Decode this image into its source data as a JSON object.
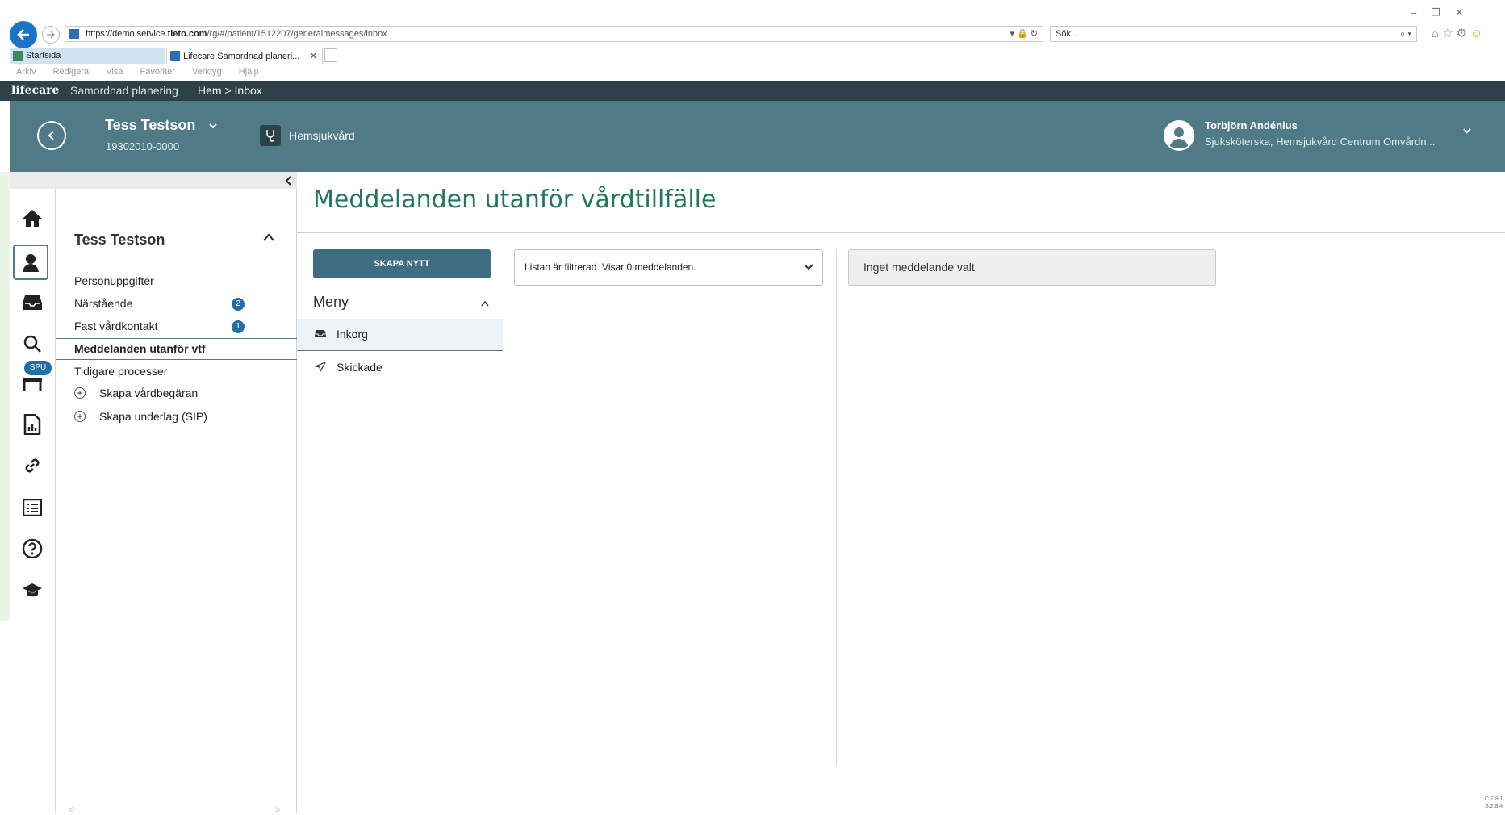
{
  "browser": {
    "url_prefix": "https://demo.service.",
    "url_domain": "tieto.com",
    "url_path": "/rg/#/patient/1512207/generalmessages/inbox",
    "search_placeholder": "Sök...",
    "tabs": [
      {
        "label": "Startsida"
      },
      {
        "label": "Lifecare Samordnad planeri..."
      }
    ],
    "menu": [
      "Arkiv",
      "Redigera",
      "Visa",
      "Favoriter",
      "Verktyg",
      "Hjälp"
    ]
  },
  "app": {
    "brand": "lifecare",
    "module": "Samordnad planering",
    "breadcrumb": "Hem > Inbox"
  },
  "patient": {
    "name": "Tess Testson",
    "id": "19302010-0000",
    "unit": "Hemsjukvård"
  },
  "user": {
    "name": "Torbjörn Andénius",
    "role": "Sjuksköterska, Hemsjukvård Centrum Omvårdn..."
  },
  "rail": {
    "spu_badge": "SPU"
  },
  "nav": {
    "title": "Tess Testson",
    "items": [
      {
        "label": "Personuppgifter"
      },
      {
        "label": "Närstående",
        "badge": "2"
      },
      {
        "label": "Fast vårdkontakt",
        "badge": "1"
      },
      {
        "label": "Meddelanden utanför vtf"
      },
      {
        "label": "Tidigare processer"
      },
      {
        "label": "Skapa vårdbegäran"
      },
      {
        "label": "Skapa underlag (SIP)"
      }
    ]
  },
  "main": {
    "title": "Meddelanden utanför vårdtillfälle",
    "create_button": "SKAPA NYTT",
    "menu_title": "Meny",
    "menu_items": [
      {
        "label": "Inkorg"
      },
      {
        "label": "Skickade"
      }
    ],
    "filter_text": "Listan är filtrerad. Visar 0 meddelanden.",
    "no_message": "Inget meddelande valt"
  },
  "footer": {
    "version_1": "C.2.8.1",
    "version_2": "S.2.8.4"
  },
  "colors": {
    "topbar": "#2d4149",
    "patientbar": "#4f7a86",
    "accent_green": "#1f7a5c",
    "badge_blue": "#1f6fa8",
    "button": "#3f6e82"
  }
}
